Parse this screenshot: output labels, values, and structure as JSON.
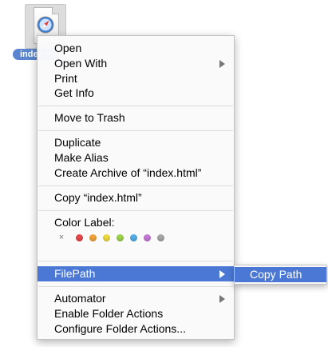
{
  "file": {
    "label": "index.html",
    "icon": "safari-document-icon"
  },
  "menu": {
    "open": "Open",
    "open_with": "Open With",
    "print": "Print",
    "get_info": "Get Info",
    "move_to_trash": "Move to Trash",
    "duplicate": "Duplicate",
    "make_alias": "Make Alias",
    "create_archive": "Create Archive of “index.html”",
    "copy": "Copy “index.html”",
    "color_label": "Color Label:",
    "color_label_none": "×",
    "colors": [
      "#e8484a",
      "#f2a33a",
      "#eedb3f",
      "#9fd34c",
      "#52aee8",
      "#c47ad6",
      "#a8a8a8"
    ],
    "filepath": "FilePath",
    "automator": "Automator",
    "enable_folder_actions": "Enable Folder Actions",
    "configure_folder_actions": "Configure Folder Actions..."
  },
  "submenu": {
    "copy_path": "Copy Path"
  },
  "theme": {
    "highlight": "#4a78d4"
  }
}
